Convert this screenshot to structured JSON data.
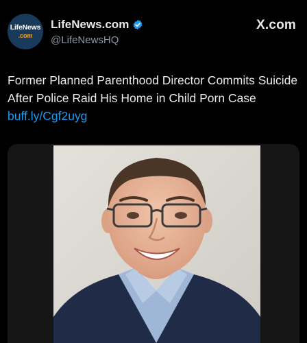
{
  "account": {
    "avatar_text": "LifeNews",
    "avatar_subtext": ".com",
    "display_name": "LifeNews.com",
    "handle": "@LifeNewsHQ",
    "verified_icon": "verified-badge-icon"
  },
  "platform": {
    "logo_text": "X.com"
  },
  "tweet": {
    "text": "Former Planned Parenthood Director Commits Suicide After Police Raid His Home in Child Porn Case ",
    "link": "buff.ly/Cgf2uyg"
  },
  "colors": {
    "background": "#000000",
    "text": "#e7e9ea",
    "secondary_text": "#8b98a5",
    "link": "#1d9bf0",
    "verified": "#1d9bf0"
  }
}
